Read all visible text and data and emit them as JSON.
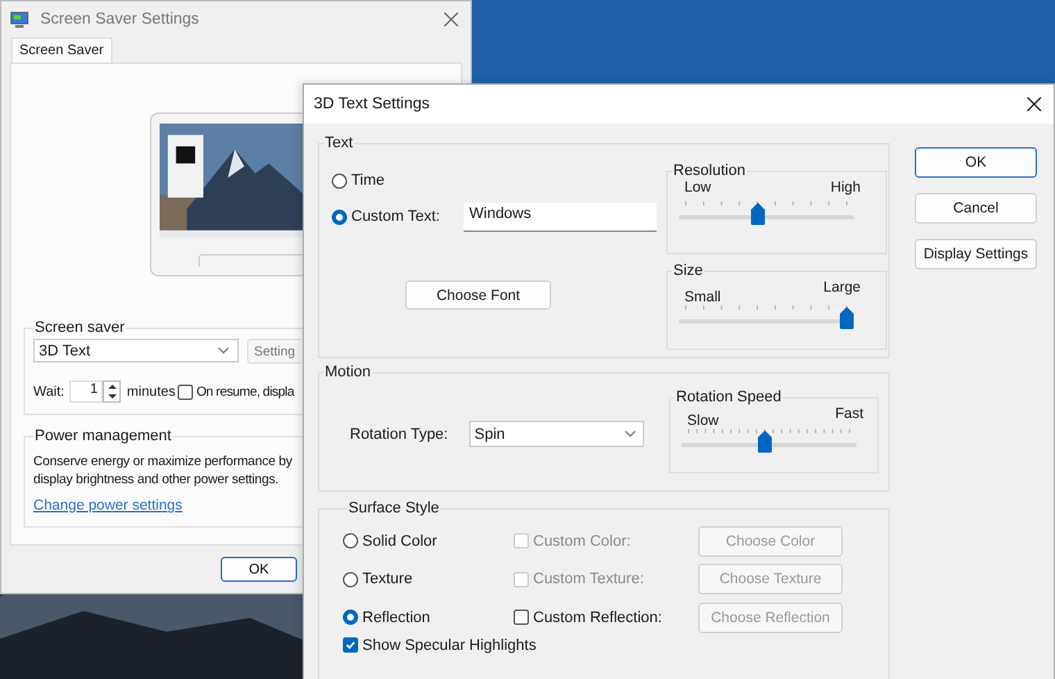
{
  "background_window": {
    "title": "Screen Saver Settings",
    "tabs": [
      {
        "label": "Screen Saver",
        "selected": true
      }
    ],
    "screen_saver": {
      "label": "Screen saver",
      "value": "3D Text",
      "settings_button": "Setting",
      "wait_label": "Wait:",
      "wait_value": "1",
      "minutes_label": "minutes",
      "on_resume": {
        "label": "On resume, displa",
        "checked": false
      }
    },
    "power": {
      "label": "Power management",
      "text": "Conserve energy or maximize performance by\ndisplay brightness and other power settings.",
      "link": "Change power settings"
    },
    "ok_button": "OK"
  },
  "dialog": {
    "title": "3D Text Settings",
    "text_group": {
      "label": "Text",
      "options": [
        {
          "label": "Time",
          "selected": false
        },
        {
          "label": "Custom Text:",
          "selected": true
        }
      ],
      "custom_text": "Windows",
      "font_button": "Choose Font",
      "resolution": {
        "label": "Resolution",
        "min_label": "Low",
        "max_label": "High",
        "level": 0.45
      },
      "size": {
        "label": "Size",
        "min_label": "Small",
        "max_label": "Large",
        "level": 1.0
      }
    },
    "motion": {
      "label": "Motion",
      "rotation_type_label": "Rotation Type:",
      "rotation_type": "Spin",
      "speed": {
        "label": "Rotation Speed",
        "min_label": "Slow",
        "max_label": "Fast",
        "level": 0.47
      }
    },
    "surface": {
      "label": "Surface Style",
      "rows": [
        {
          "radio": {
            "label": "Solid Color",
            "selected": false
          },
          "checkbox": {
            "label": "Custom Color:",
            "checked": false,
            "disabled": true
          },
          "button": {
            "label": "Choose Color",
            "disabled": true
          }
        },
        {
          "radio": {
            "label": "Texture",
            "selected": false
          },
          "checkbox": {
            "label": "Custom Texture:",
            "checked": false,
            "disabled": true
          },
          "button": {
            "label": "Choose Texture",
            "disabled": true
          }
        },
        {
          "radio": {
            "label": "Reflection",
            "selected": true
          },
          "checkbox": {
            "label": "Custom Reflection:",
            "checked": false,
            "disabled": false
          },
          "button": {
            "label": "Choose Reflection",
            "disabled": true
          }
        }
      ],
      "specular": {
        "label": "Show Specular Highlights",
        "checked": true
      }
    },
    "buttons": [
      {
        "label": "OK",
        "default": true
      },
      {
        "label": "Cancel",
        "default": false
      },
      {
        "label": "Display Settings",
        "default": false
      }
    ]
  }
}
